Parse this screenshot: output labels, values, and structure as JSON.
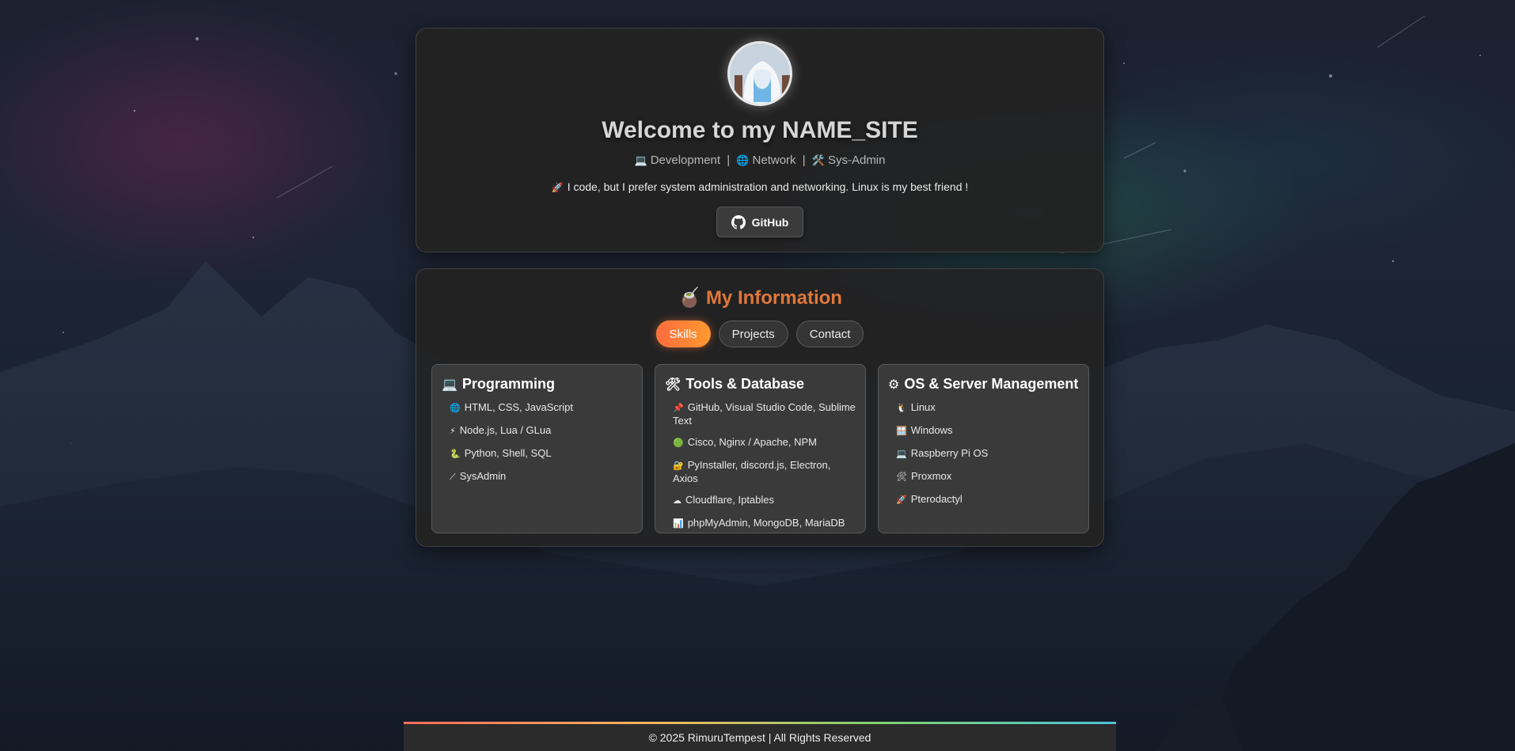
{
  "hero": {
    "title": "Welcome to my NAME_SITE",
    "tags": [
      {
        "icon": "💻",
        "label": "Development"
      },
      {
        "icon": "🌐",
        "label": "Network"
      },
      {
        "icon": "🛠️",
        "label": "Sys-Admin"
      }
    ],
    "separator": "|",
    "bio_icon": "🚀",
    "bio": "I code, but I prefer system administration and networking. Linux is my best friend !",
    "github_label": "GitHub"
  },
  "info": {
    "title_icon": "🧉",
    "title": "My Information",
    "tabs": [
      {
        "label": "Skills",
        "active": true
      },
      {
        "label": "Projects",
        "active": false
      },
      {
        "label": "Contact",
        "active": false
      }
    ],
    "columns": [
      {
        "icon": "💻",
        "title": "Programming",
        "items": [
          {
            "icon": "🌐",
            "label": "HTML, CSS, JavaScript"
          },
          {
            "icon": "⚡",
            "label": "Node.js, Lua / GLua"
          },
          {
            "icon": "🐍",
            "label": "Python, Shell, SQL"
          },
          {
            "icon": "⟋",
            "label": "SysAdmin"
          }
        ]
      },
      {
        "icon": "🛠",
        "title": "Tools & Database",
        "items": [
          {
            "icon": "📌",
            "label": "GitHub, Visual Studio Code, Sublime Text"
          },
          {
            "icon": "🟢",
            "label": "Cisco, Nginx / Apache, NPM"
          },
          {
            "icon": "🔐",
            "label": "PyInstaller, discord.js, Electron, Axios"
          },
          {
            "icon": "☁",
            "label": "Cloudflare, Iptables"
          },
          {
            "icon": "📊",
            "label": "phpMyAdmin, MongoDB, MariaDB"
          }
        ]
      },
      {
        "icon": "⚙",
        "title": "OS & Server Management",
        "items": [
          {
            "icon": "🐧",
            "label": "Linux"
          },
          {
            "icon": "🪟",
            "label": "Windows"
          },
          {
            "icon": "💻",
            "label": "Raspberry Pi OS"
          },
          {
            "icon": "🛠",
            "label": "Proxmox"
          },
          {
            "icon": "🚀",
            "label": "Pterodactyl"
          }
        ]
      }
    ]
  },
  "footer": {
    "text": "© 2025 RimuruTempest | All Rights Reserved"
  },
  "colors": {
    "accent": "#e0773a",
    "tab_active_start": "#ff6b3d",
    "tab_active_end": "#ff9a2f"
  }
}
